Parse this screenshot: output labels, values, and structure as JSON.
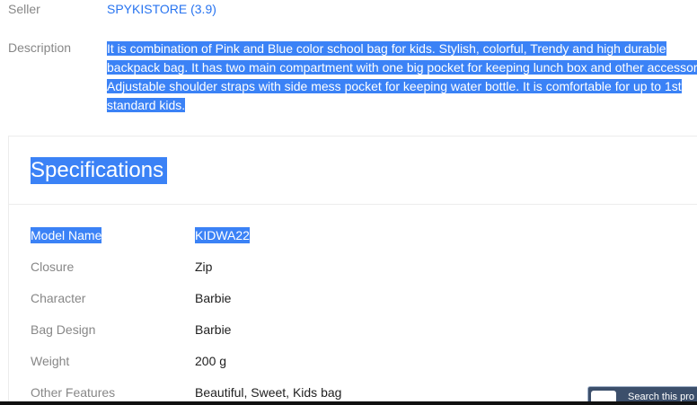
{
  "seller": {
    "label": "Seller",
    "value": "SPYKISTORE (3.9)"
  },
  "description": {
    "label": "Description",
    "lines": [
      "It is combination of Pink and Blue color school bag for kids. Stylish, colorful, Trendy and high durable",
      "backpack bag. It has two main compartment with one big pocket for keeping lunch box and other accessories.",
      "Adjustable shoulder straps with side mess pocket for keeping water bottle. It is comfortable for up to 1st",
      "standard kids."
    ]
  },
  "specifications": {
    "title": "Specifications",
    "rows": [
      {
        "key": "Model Name",
        "value": "KIDWA22"
      },
      {
        "key": "Closure",
        "value": "Zip"
      },
      {
        "key": "Character",
        "value": "Barbie"
      },
      {
        "key": "Bag Design",
        "value": "Barbie"
      },
      {
        "key": "Weight",
        "value": "200 g"
      },
      {
        "key": "Other Features",
        "value": "Beautiful, Sweet, Kids bag"
      }
    ]
  },
  "search_widget": {
    "label": "Search this pro",
    "icon": "search-widget-icon"
  },
  "colors": {
    "selection": "#3b82f6",
    "link": "#2874f0",
    "muted": "#878787"
  }
}
